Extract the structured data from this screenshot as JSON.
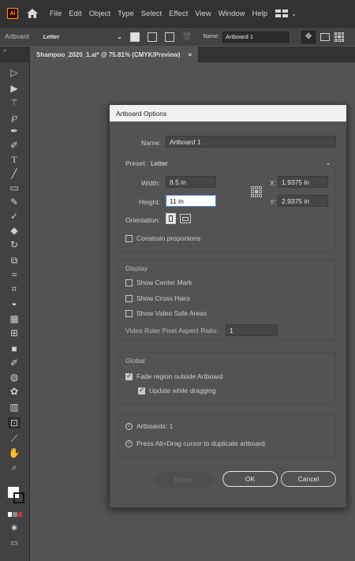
{
  "menubar": {
    "logo": "Ai",
    "items": [
      "File",
      "Edit",
      "Object",
      "Type",
      "Select",
      "Effect",
      "View",
      "Window",
      "Help"
    ]
  },
  "controlbar": {
    "label": "Artboard",
    "preset": "Letter",
    "name_label": "Name:",
    "name_value": "Artboard 1"
  },
  "tabs": {
    "expand": "»",
    "doc_title": "Shampoo_2020_1.ai* @ 75.81% (CMYK/Preview)",
    "close": "×"
  },
  "dialog": {
    "title": "Artboard Options",
    "name_label": "Name:",
    "name_value": "Artboard 1",
    "preset_label": "Preset:",
    "preset_value": "Letter",
    "width_label": "Width:",
    "width_value": "8.5 in",
    "height_label": "Height:",
    "height_value": "11 in",
    "x_label": "X:",
    "x_value": "1.9375 in",
    "y_label": "Y:",
    "y_value": "2.9375 in",
    "orientation_label": "Orientation:",
    "constrain_label": "Constrain proportions",
    "display_heading": "Display",
    "show_center_mark": "Show Center Mark",
    "show_cross_hairs": "Show Cross Hairs",
    "show_video_safe": "Show Video Safe Areas",
    "video_ratio_label": "Video Ruler Pixel Aspect Ratio:",
    "video_ratio_value": "1",
    "global_heading": "Global",
    "fade_region": "Fade region outside Artboard",
    "update_dragging": "Update while dragging",
    "info_artboards": "Artboards: 1",
    "info_press": "Press Alt+Drag cursor to duplicate artboard.",
    "delete_label": "Delete",
    "ok_label": "OK",
    "cancel_label": "Cancel"
  },
  "tools": [
    "selection-icon",
    "direct-selection-icon",
    "magic-wand-icon",
    "lasso-icon",
    "pen-icon",
    "curvature-icon",
    "type-icon",
    "line-icon",
    "rectangle-icon",
    "paintbrush-icon",
    "shaper-icon",
    "eraser-icon",
    "rotate-icon",
    "scale-icon",
    "warp-icon",
    "free-transform-icon",
    "shape-builder-icon",
    "perspective-grid-icon",
    "mesh-icon",
    "gradient-icon",
    "eyedropper-icon",
    "blend-icon",
    "symbol-sprayer-icon",
    "column-graph-icon",
    "artboard-icon",
    "slice-icon",
    "hand-icon",
    "zoom-icon"
  ]
}
